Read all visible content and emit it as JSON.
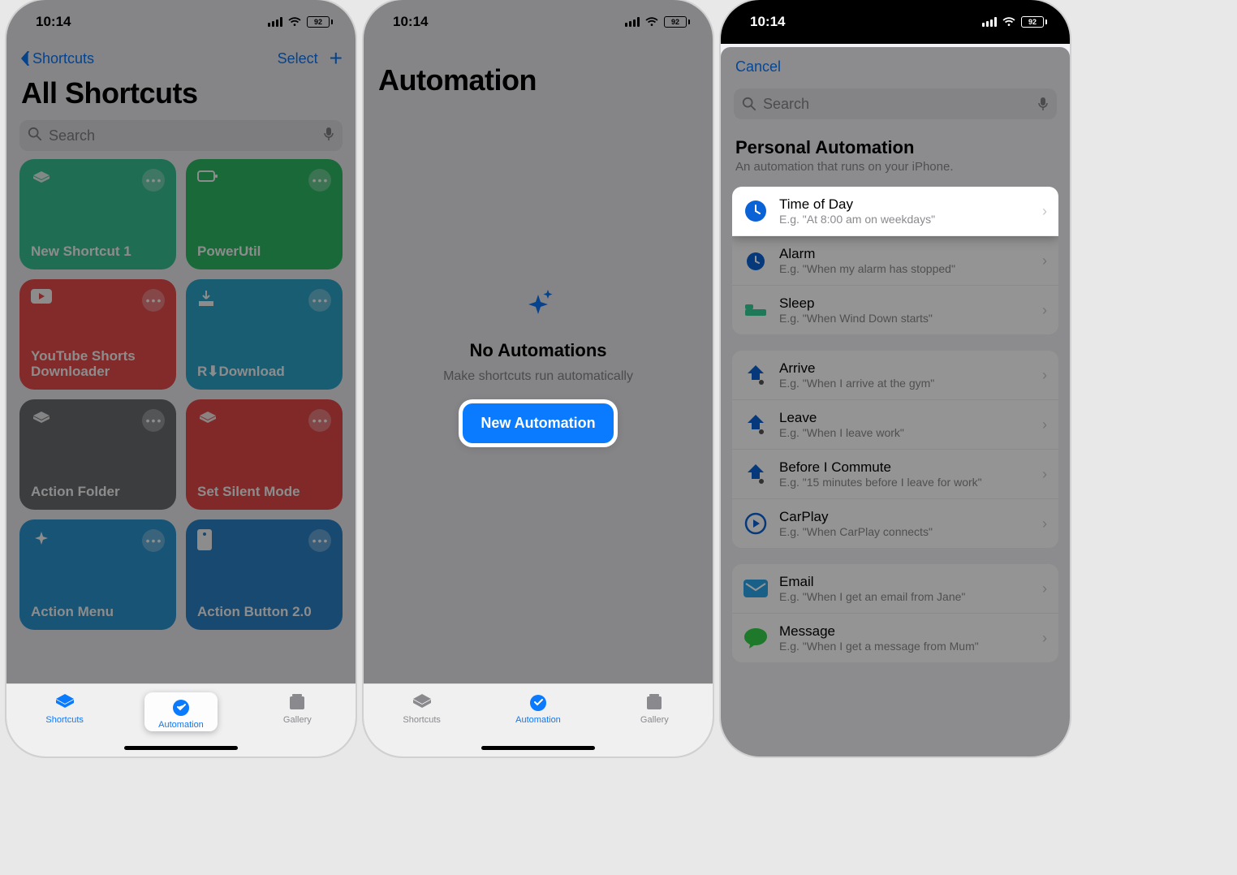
{
  "status": {
    "time": "10:14",
    "battery_pct": "92"
  },
  "phone1": {
    "back_label": "Shortcuts",
    "select_label": "Select",
    "title": "All Shortcuts",
    "search_placeholder": "Search",
    "cards": [
      {
        "name": "New Shortcut 1"
      },
      {
        "name": "PowerUtil"
      },
      {
        "name": "YouTube Shorts Downloader"
      },
      {
        "name": "R⬇Download"
      },
      {
        "name": "Action Folder"
      },
      {
        "name": "Set Silent Mode"
      },
      {
        "name": "Action Menu"
      },
      {
        "name": "Action Button 2.0"
      }
    ],
    "tabs": {
      "shortcuts": "Shortcuts",
      "automation": "Automation",
      "gallery": "Gallery"
    }
  },
  "phone2": {
    "title": "Automation",
    "empty_title": "No Automations",
    "empty_subtitle": "Make shortcuts run automatically",
    "button_label": "New Automation",
    "tabs": {
      "shortcuts": "Shortcuts",
      "automation": "Automation",
      "gallery": "Gallery"
    }
  },
  "phone3": {
    "cancel": "Cancel",
    "search_placeholder": "Search",
    "section_title": "Personal Automation",
    "section_subtitle": "An automation that runs on your iPhone.",
    "rows_a": [
      {
        "title": "Time of Day",
        "sub": "E.g. \"At 8:00 am on weekdays\""
      },
      {
        "title": "Alarm",
        "sub": "E.g. \"When my alarm has stopped\""
      },
      {
        "title": "Sleep",
        "sub": "E.g. \"When Wind Down starts\""
      }
    ],
    "rows_b": [
      {
        "title": "Arrive",
        "sub": "E.g. \"When I arrive at the gym\""
      },
      {
        "title": "Leave",
        "sub": "E.g. \"When I leave work\""
      },
      {
        "title": "Before I Commute",
        "sub": "E.g. \"15 minutes before I leave for work\""
      },
      {
        "title": "CarPlay",
        "sub": "E.g. \"When CarPlay connects\""
      }
    ],
    "rows_c": [
      {
        "title": "Email",
        "sub": "E.g. \"When I get an email from Jane\""
      },
      {
        "title": "Message",
        "sub": "E.g. \"When I get a message from Mum\""
      }
    ]
  }
}
